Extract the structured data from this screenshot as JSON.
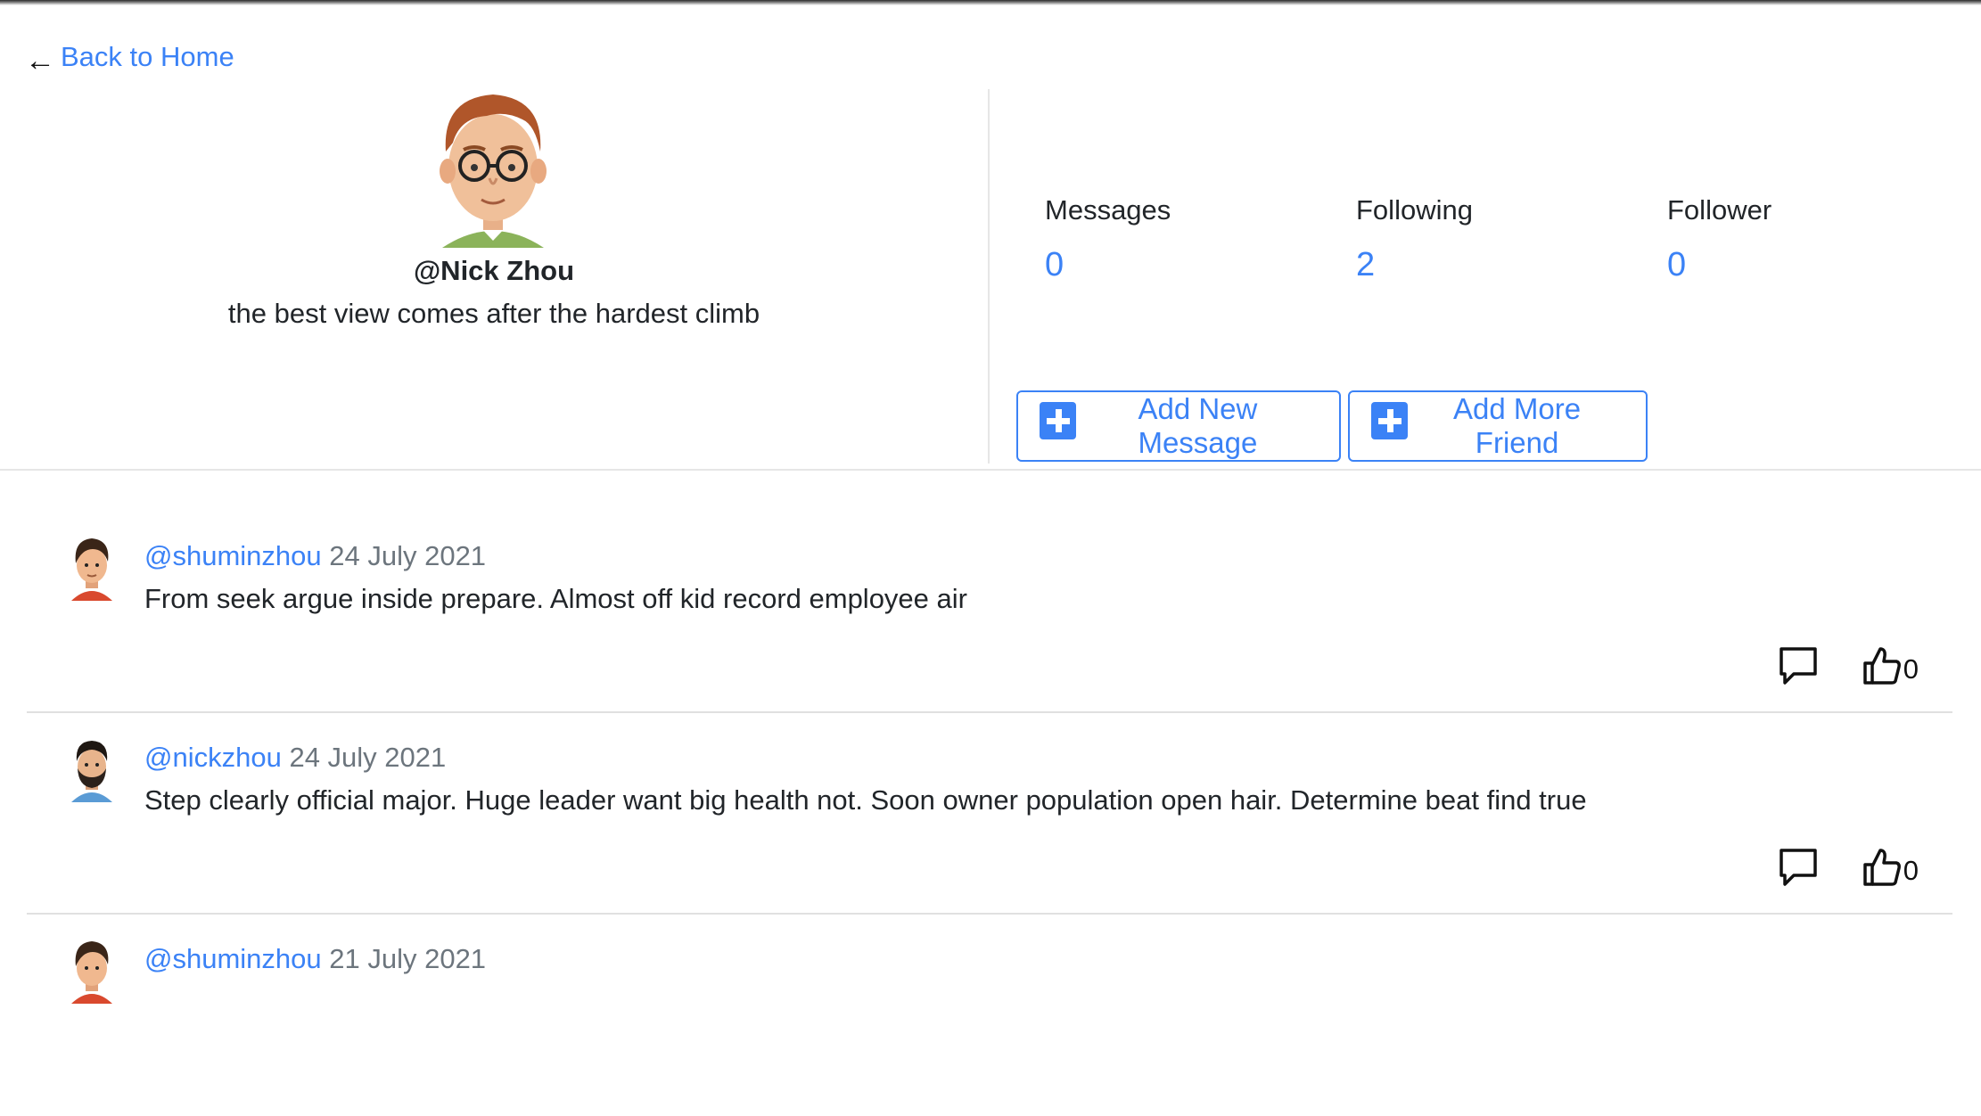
{
  "nav": {
    "back_label": "Back to Home"
  },
  "profile": {
    "username": "@Nick Zhou",
    "bio": "the best view comes after the hardest climb"
  },
  "stats": [
    {
      "label": "Messages",
      "value": "0"
    },
    {
      "label": "Following",
      "value": "2"
    },
    {
      "label": "Follower",
      "value": "0"
    }
  ],
  "actions": {
    "add_message": "Add New Message",
    "add_friend": "Add More Friend"
  },
  "feed": [
    {
      "user": "@shuminzhou",
      "date": "24 July 2021",
      "text": "From seek argue inside prepare. Almost off kid record employee air",
      "likes": "0"
    },
    {
      "user": "@nickzhou",
      "date": "24 July 2021",
      "text": "Step clearly official major. Huge leader want big health not. Soon owner population open hair. Determine beat find true",
      "likes": "0"
    },
    {
      "user": "@shuminzhou",
      "date": "21 July 2021",
      "text": "",
      "likes": ""
    }
  ],
  "colors": {
    "accent": "#3b82f6",
    "muted": "#6c757d",
    "text": "#212529"
  }
}
